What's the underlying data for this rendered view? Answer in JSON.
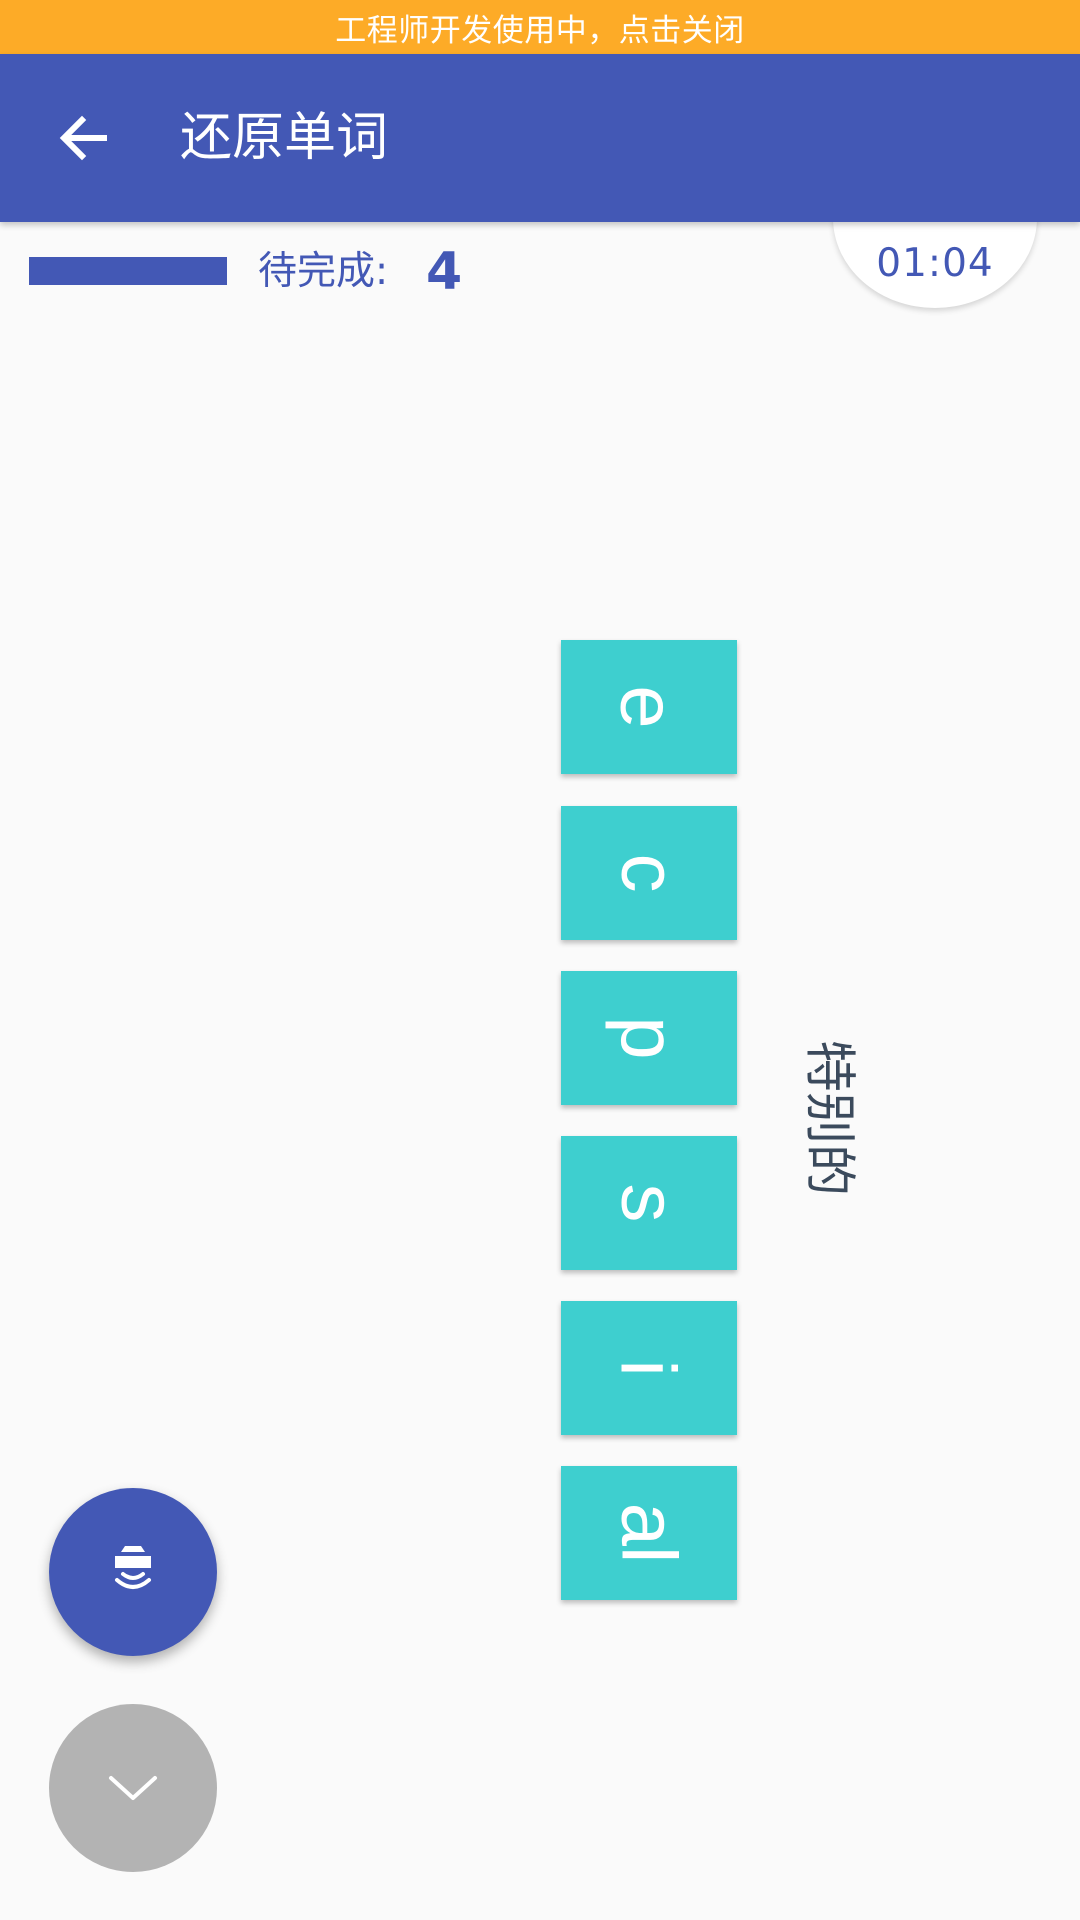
{
  "dev_banner": {
    "text": "工程师开发使用中，点击关闭"
  },
  "app_bar": {
    "title": "还原单词",
    "back_icon": "arrow-left-icon"
  },
  "status": {
    "progress_fraction": 1.0,
    "remaining_label": "待完成:",
    "remaining_count": "4",
    "timer": "01:04"
  },
  "tiles": [
    {
      "letter": "e"
    },
    {
      "letter": "c"
    },
    {
      "letter": "p"
    },
    {
      "letter": "s"
    },
    {
      "letter": "i"
    },
    {
      "letter": "al"
    }
  ],
  "meaning": "特别的",
  "fabs": {
    "speak_icon": "speaker-sound-icon",
    "down_icon": "chevron-down-icon"
  },
  "colors": {
    "primary": "#4358b5",
    "banner": "#fdab27",
    "tile": "#3ecfcf",
    "fab_disabled": "#b3b3b3",
    "meaning_text": "#3b4a5c"
  }
}
